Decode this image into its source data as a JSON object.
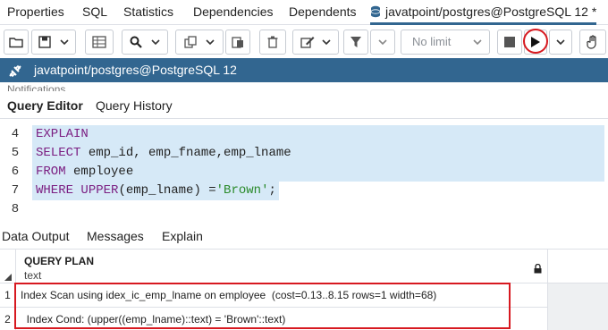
{
  "tabs": [
    {
      "label": "Properties"
    },
    {
      "label": "SQL"
    },
    {
      "label": "Statistics"
    },
    {
      "label": "Dependencies"
    },
    {
      "label": "Dependents"
    },
    {
      "label": "javatpoint/postgres@PostgreSQL 12 *"
    }
  ],
  "toolbar": {
    "limit_placeholder": "No limit",
    "buttons": [
      "open-file",
      "save",
      "save-dropdown",
      "table",
      "find",
      "find-dropdown",
      "copy",
      "copy-dropdown",
      "paste",
      "delete",
      "edit",
      "edit-dropdown",
      "filter",
      "filter-dropdown",
      "stop",
      "execute",
      "execute-dropdown",
      "hand"
    ]
  },
  "connection": {
    "label": "javatpoint/postgres@PostgreSQL 12"
  },
  "notification": "Notifications",
  "editor_tabs": [
    {
      "label": "Query Editor"
    },
    {
      "label": "Query History"
    }
  ],
  "editor": {
    "lines": [
      {
        "num": "4",
        "tokens": [
          {
            "t": "EXPLAIN",
            "c": "kw"
          }
        ]
      },
      {
        "num": "5",
        "tokens": [
          {
            "t": "SELECT",
            "c": "kw"
          },
          {
            "t": " emp_id, emp_fname,emp_lname",
            "c": ""
          }
        ]
      },
      {
        "num": "6",
        "tokens": [
          {
            "t": "FROM",
            "c": "kw"
          },
          {
            "t": " employee",
            "c": ""
          }
        ]
      },
      {
        "num": "7",
        "tokens": [
          {
            "t": "WHERE",
            "c": "kw"
          },
          {
            "t": " ",
            "c": ""
          },
          {
            "t": "UPPER",
            "c": "kw"
          },
          {
            "t": "(emp_lname) =",
            "c": ""
          },
          {
            "t": "'Brown'",
            "c": "str"
          },
          {
            "t": ";",
            "c": ""
          }
        ]
      },
      {
        "num": "8",
        "tokens": []
      }
    ]
  },
  "output_tabs": [
    {
      "label": "Data Output"
    },
    {
      "label": "Messages"
    },
    {
      "label": "Explain"
    }
  ],
  "grid": {
    "column": {
      "name": "QUERY PLAN",
      "type": "text"
    },
    "rows": [
      {
        "num": "1",
        "value": "Index Scan using idex_ic_emp_lname on employee  (cost=0.13..8.15 rows=1 width=68)"
      },
      {
        "num": "2",
        "value": "  Index Cond: (upper((emp_lname)::text) = 'Brown'::text)"
      }
    ]
  },
  "colors": {
    "accent": "#326690",
    "highlight": "#d71920",
    "selection": "#d6e9f7",
    "keyword": "#7b1f82",
    "string": "#2a8a2a"
  }
}
